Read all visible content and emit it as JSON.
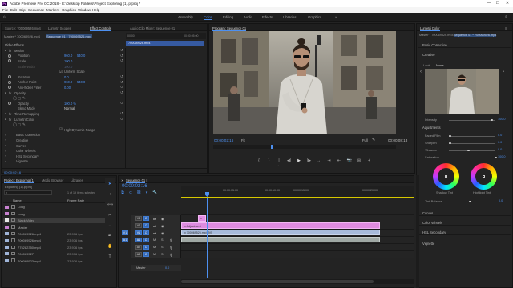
{
  "window": {
    "app_badge": "Pr",
    "title": "Adobe Premiere Pro CC 2018 - E:\\Desktop Folders\\Project Exploring (1).prproj *",
    "minimize": "—",
    "maximize": "☐",
    "close": "✕"
  },
  "menu": [
    "File",
    "Edit",
    "Clip",
    "Sequence",
    "Markers",
    "Graphics",
    "Window",
    "Help"
  ],
  "workspaces": {
    "items": [
      "Assembly",
      "Color",
      "Editing",
      "Audio",
      "Effects",
      "Libraries",
      "Graphics"
    ],
    "active": "Color",
    "overflow": "»"
  },
  "source_panel": {
    "tabs": [
      "Source: 700069526.mp4",
      "Lumetri Scopes",
      "Effect Controls",
      "Audio Clip Mixer: Sequence 01"
    ],
    "active_tab": "Effect Controls",
    "master_label": "Master * 700069526.mp4",
    "sequence_label": "Sequence 01 * 700069526.mp4",
    "mini_timeline_start": "00:00",
    "mini_timeline_end": "00:00:05:00",
    "clip_label": "700069526.mp4",
    "video_effects": "Video Effects",
    "properties": [
      {
        "label": "Motion",
        "kind": "group",
        "fx": true
      },
      {
        "label": "Position",
        "v1": "960.0",
        "v2": "540.0",
        "keyframe": true
      },
      {
        "label": "Scale",
        "v1": "100.0",
        "keyframe": true
      },
      {
        "label": "Scale Width",
        "v1": "100.0",
        "disabled": true
      },
      {
        "label": "",
        "check": "Uniform Scale"
      },
      {
        "label": "Rotation",
        "v1": "0.0",
        "keyframe": true
      },
      {
        "label": "Anchor Point",
        "v1": "960.0",
        "v2": "540.0",
        "keyframe": true
      },
      {
        "label": "Anti-flicker Filter",
        "v1": "0.00",
        "keyframe": true
      },
      {
        "label": "Opacity",
        "kind": "group",
        "fx": true
      },
      {
        "label": "",
        "kind": "masks"
      },
      {
        "label": "Opacity",
        "v1": "100.0 %",
        "keyframe": true
      },
      {
        "label": "Blend Mode",
        "select": "Normal"
      },
      {
        "label": "Time Remapping",
        "kind": "group",
        "fx": true
      },
      {
        "label": "Lumetri Color",
        "kind": "group",
        "fx": true
      },
      {
        "label": "",
        "kind": "masks"
      },
      {
        "label": "",
        "check": "High Dynamic Range"
      },
      {
        "label": "Basic Correction",
        "kind": "sub"
      },
      {
        "label": "Creative",
        "kind": "sub"
      },
      {
        "label": "Curves",
        "kind": "sub"
      },
      {
        "label": "Color Wheels",
        "kind": "sub"
      },
      {
        "label": "HSL Secondary",
        "kind": "sub"
      },
      {
        "label": "Vignette",
        "kind": "sub"
      }
    ],
    "timecode": "00:00:02:16"
  },
  "program": {
    "tab": "Program: Sequence 01",
    "timecode": "00:00:02:16",
    "fit": "Fit",
    "quality": "Full",
    "duration": "00:00:08:13",
    "transport": [
      "{",
      "}",
      "|←",
      "◀|",
      "▶",
      "|▶",
      "→|",
      "⇥",
      "⇤",
      "📷",
      "⊞",
      "+"
    ]
  },
  "project": {
    "tabs": [
      "Project: Exploring (1)",
      "Media Browser",
      "Libraries"
    ],
    "active_tab": "Project: Exploring (1)",
    "name": "Exploring (1).prproj",
    "selection_info": "1 of 19 items selected",
    "search_placeholder": "",
    "columns": [
      "Name",
      "Frame Rate",
      "M"
    ],
    "items": [
      {
        "name": "Long",
        "color": "#c781d0",
        "fps": ""
      },
      {
        "name": "Long",
        "color": "#c781d0",
        "fps": ""
      },
      {
        "name": "Black Video",
        "color": "#e7e7e7",
        "fps": "",
        "selected": true
      },
      {
        "name": "Master",
        "color": "#c781d0",
        "fps": ""
      },
      {
        "name": "700069526.mp4",
        "color": "#9fb4d8",
        "fps": "23.976 fps"
      },
      {
        "name": "700069526.mp4",
        "color": "#9fb4d8",
        "fps": "23.976 fps"
      },
      {
        "name": "775282350.mp4",
        "color": "#9fb4d8",
        "fps": "23.976 fps"
      },
      {
        "name": "700069527",
        "color": "#9fb4d8",
        "fps": "23.976 fps"
      },
      {
        "name": "700069523.mp4",
        "color": "#9fb4d8",
        "fps": "23.976 fps"
      }
    ]
  },
  "timeline": {
    "tab": "Sequence 01",
    "timecode": "00:00:02:16",
    "ruler": [
      "00:00",
      "00:00:05:00",
      "00:00:10:00",
      "00:00:15:00",
      "00:00:20:00"
    ],
    "tracks": [
      {
        "name": "V3"
      },
      {
        "name": "V2"
      },
      {
        "name": "V1"
      },
      {
        "name": "A1"
      },
      {
        "name": "A2"
      },
      {
        "name": "A3"
      }
    ],
    "master_label": "Master",
    "master_value": "0.0",
    "clips": {
      "adj": "fx",
      "v2": "fx Adjustment",
      "v1": "fx 700069526.mp4 [V]"
    }
  },
  "lumetri": {
    "tab": "Lumetri Color",
    "master_label": "Master * 700069526.mp4",
    "sequence_label": "Sequence 01 * 700069526.mp4",
    "basic_correction": "Basic Correction",
    "creative": "Creative",
    "look_label": "Look",
    "look_value": "None",
    "intensity_label": "Intensity",
    "intensity_value": "100.0",
    "adjustments": "Adjustments",
    "adjust_rows": [
      {
        "label": "Faded Film",
        "value": "0.0"
      },
      {
        "label": "Sharpen",
        "value": "0.0"
      },
      {
        "label": "Vibrance",
        "value": "0.0"
      },
      {
        "label": "Saturation",
        "value": "100.0"
      }
    ],
    "shadow_tint": "Shadow Tint",
    "highlight_tint": "Highlight Tint",
    "tint_balance_label": "Tint Balance",
    "tint_balance_value": "0.0",
    "sections": [
      "Curves",
      "Color Wheels",
      "HSL Secondary",
      "Vignette"
    ]
  }
}
